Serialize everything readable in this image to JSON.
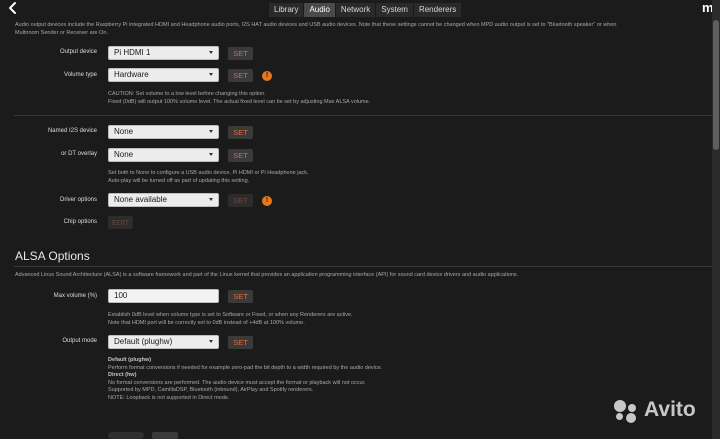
{
  "nav": {
    "tabs": [
      {
        "label": "Library"
      },
      {
        "label": "Audio"
      },
      {
        "label": "Network"
      },
      {
        "label": "System"
      },
      {
        "label": "Renderers"
      }
    ],
    "active_tab": "Audio",
    "brand": "m"
  },
  "intro": {
    "line1": "Audio output devices include the Raspberry Pi integrated HDMI and Headphone audio ports, I2S HAT audio devices and USB audio devices. Note that these settings cannot be changed when MPD audio output is set to \"Bluetooth speaker\" or when",
    "line2": "Multiroom Sender or Receiver are On."
  },
  "output_device": {
    "label": "Output device",
    "value": "Pi HDMI 1",
    "button": "SET"
  },
  "volume_type": {
    "label": "Volume type",
    "value": "Hardware",
    "button": "SET",
    "note1": "CAUTION: Set volume to a low level before changing this option.",
    "note2": "Fixed (0dB) will output 100% volume level. The actual fixed level can be set by adjusting Max ALSA volume."
  },
  "i2s_device": {
    "label": "Named I2S device",
    "value": "None",
    "button": "SET"
  },
  "dt_overlay": {
    "label": "or DT overlay",
    "value": "None",
    "button": "SET",
    "note1": "Set both to None to configure a USB audio device, Pi HDMI or Pi Headphone jack.",
    "note2": "Auto-play will be turned off as part of updating this setting."
  },
  "driver_options": {
    "label": "Driver options",
    "value": "None available",
    "button": "SET"
  },
  "chip_options": {
    "label": "Chip options",
    "button": "EDIT"
  },
  "alsa": {
    "heading": "ALSA Options",
    "description": "Advanced Linux Sound Architecture (ALSA) is a software framework and part of the Linux kernel that provides an application programming interface (API) for sound card device drivers and audio applications."
  },
  "max_volume": {
    "label": "Max volume (%)",
    "value": "100",
    "button": "SET",
    "note1": "Establish 0dB level when volume type is set to Software or Fixed, or when any Renderers are active.",
    "note2": "Note that HDMI port will be correctly set to 0dB instead of +4dB at 100% volume."
  },
  "output_mode": {
    "label": "Output mode",
    "value": "Default (plughw)",
    "button": "SET",
    "lines": [
      "Default (plughw)",
      "Perform format conversions if needed for example zero-pad the bit depth to a width required by the audio device.",
      "Direct (hw)",
      "No format conversions are performed. The audio device must accept the format or playback will not occur.",
      "Supported by MPD, CamillaDSP, Bluetooth (inbound), AirPlay and Spotify renderers.",
      "NOTE: Loopback is not supported in Direct mode."
    ]
  },
  "watermark": {
    "text": "Avito"
  }
}
